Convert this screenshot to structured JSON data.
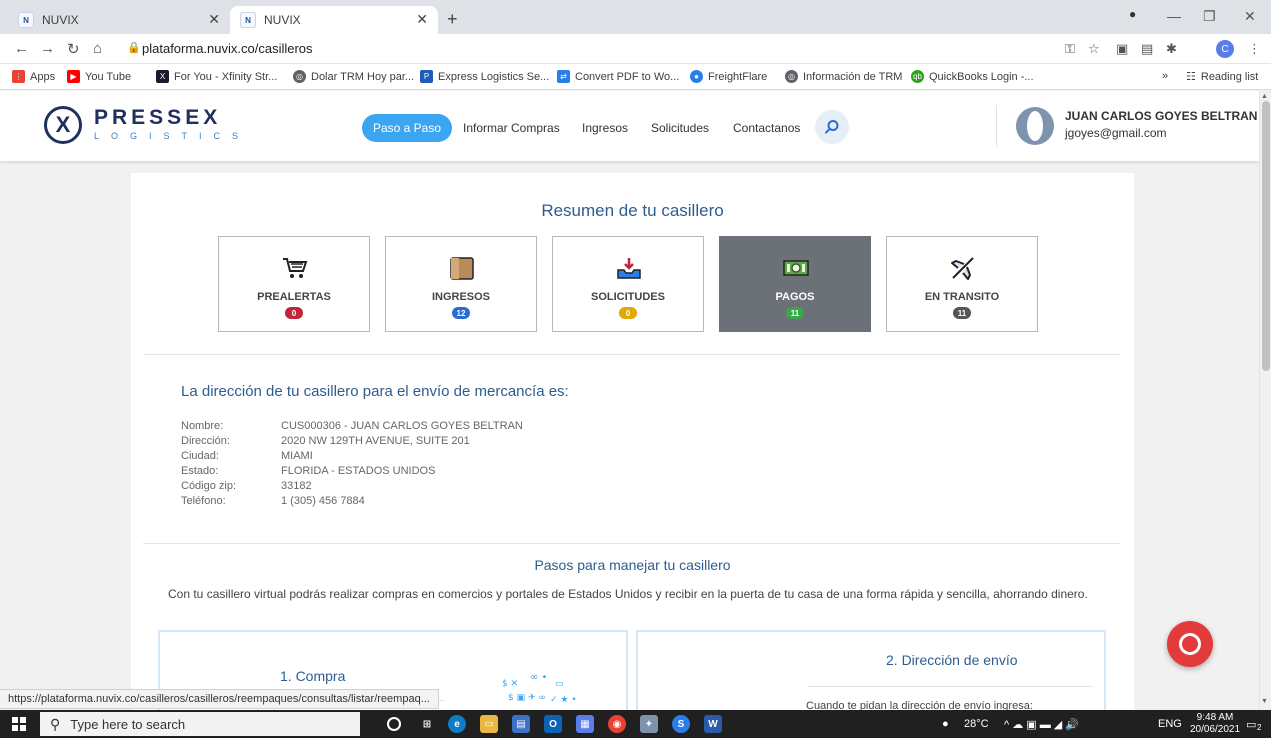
{
  "browser": {
    "tabs": [
      {
        "favicon": "N",
        "title": "NUVIX"
      },
      {
        "favicon": "N",
        "title": "NUVIX"
      }
    ],
    "url": "plataforma.nuvix.co/casilleros",
    "profile_initial": "C",
    "bookmarks": [
      {
        "label": "Apps",
        "icon": "apps-grid-icon",
        "color": "#e94235"
      },
      {
        "label": "You Tube",
        "icon": "youtube-icon",
        "color": "#ff0000"
      },
      {
        "label": "For You - Xfinity Str...",
        "icon": "xfinity-icon",
        "color": "#1a1a2e"
      },
      {
        "label": "Dolar TRM Hoy par...",
        "icon": "globe-icon",
        "color": "#5f6368"
      },
      {
        "label": "Express Logistics Se...",
        "icon": "express-logistics-icon",
        "color": "#1e5bbf"
      },
      {
        "label": "Convert PDF to Wo...",
        "icon": "convert-pdf-icon",
        "color": "#2b7de9"
      },
      {
        "label": "FreightFlare",
        "icon": "freightflare-icon",
        "color": "#2b7de9"
      },
      {
        "label": "Información de TRM",
        "icon": "globe-icon",
        "color": "#5f6368"
      },
      {
        "label": "QuickBooks Login -...",
        "icon": "quickbooks-icon",
        "color": "#2ca01c"
      }
    ],
    "reading_list": "Reading list",
    "more_bookmarks": "»"
  },
  "header": {
    "logo_mark": "X",
    "logo_text": "PRESSEX",
    "logo_sub": "LOGISTICS",
    "nav": [
      "Paso a Paso",
      "Informar Compras",
      "Ingresos",
      "Solicitudes",
      "Contactanos"
    ],
    "user_name": "JUAN CARLOS GOYES BELTRAN",
    "user_email": "jgoyes@gmail.com"
  },
  "summary": {
    "title": "Resumen de tu casillero",
    "tiles": [
      {
        "label": "PREALERTAS",
        "count": "0",
        "icon": "shopping-cart-icon",
        "badge_color": "#c0253c"
      },
      {
        "label": "INGRESOS",
        "count": "12",
        "icon": "package-box-icon",
        "badge_color": "#2b6cd4"
      },
      {
        "label": "SOLICITUDES",
        "count": "0",
        "icon": "inbox-tray-icon",
        "badge_color": "#e0a800"
      },
      {
        "label": "PAGOS",
        "count": "11",
        "icon": "money-bill-icon",
        "badge_color": "#38a848"
      },
      {
        "label": "EN TRANSITO",
        "count": "11",
        "icon": "airplane-icon",
        "badge_color": "#555555"
      }
    ]
  },
  "address": {
    "title": "La dirección de tu casillero para el envío de mercancía es:",
    "rows": [
      {
        "key": "Nombre:",
        "value": "CUS000306 - JUAN CARLOS GOYES BELTRAN"
      },
      {
        "key": "Dirección:",
        "value": "2020 NW 129TH AVENUE, SUITE 201"
      },
      {
        "key": "Ciudad:",
        "value": "MIAMI"
      },
      {
        "key": "Estado:",
        "value": "FLORIDA - ESTADOS UNIDOS"
      },
      {
        "key": "Código zip:",
        "value": "33182"
      },
      {
        "key": "Teléfono:",
        "value": "1 (305) 456 7884"
      }
    ]
  },
  "steps": {
    "title": "Pasos para manejar tu casillero",
    "text": "Con tu casillero virtual podrás realizar compras en comercios y portales de Estados Unidos y recibir en la puerta de tu casa de una forma rápida y sencilla, ahorrando dinero.",
    "step1_title": "1. Compra",
    "step2_title": "2. Dirección de envío",
    "step2_text": "Cuando te pidan la dirección de envío ingresa:"
  },
  "status_url": "https://plataforma.nuvix.co/casilleros/casilleros/reempaques/consultas/listar/reempaq...",
  "taskbar": {
    "search_placeholder": "Type here to search",
    "weather": "28°C",
    "lang": "ENG",
    "time": "9:48 AM",
    "date": "20/06/2021",
    "notif_count": "2"
  }
}
